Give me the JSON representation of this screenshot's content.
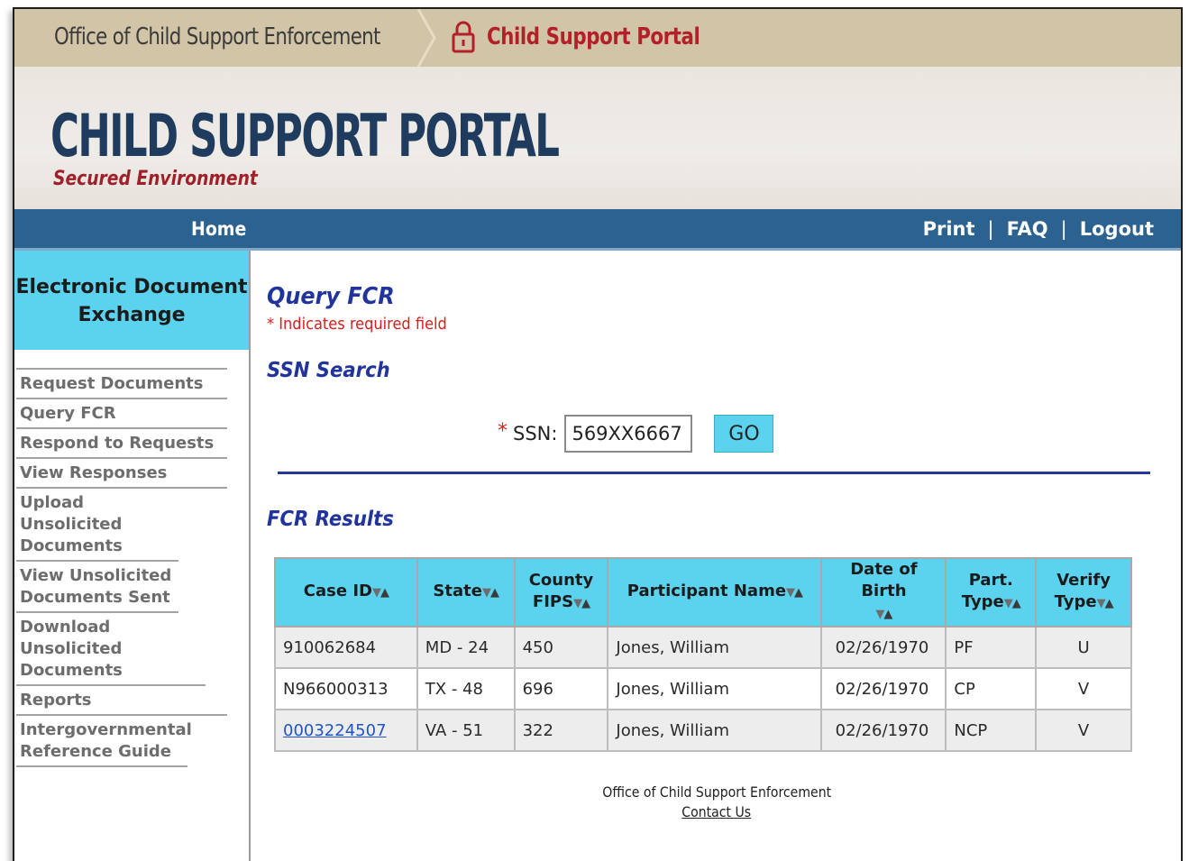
{
  "topbar": {
    "agency": "Office of Child Support Enforcement",
    "portal": "Child Support Portal",
    "lock_icon": "lock-icon"
  },
  "banner": {
    "title": "CHILD SUPPORT PORTAL",
    "subtitle": "Secured Environment"
  },
  "nav": {
    "home": "Home",
    "print": "Print",
    "faq": "FAQ",
    "logout": "Logout",
    "separator": "|"
  },
  "sidebar": {
    "heading_line1": "Electronic Document",
    "heading_line2": "Exchange",
    "items": [
      {
        "label": "Request Documents"
      },
      {
        "label": "Query FCR"
      },
      {
        "label": "Respond to Requests"
      },
      {
        "label": "View Responses"
      },
      {
        "label": "Upload Unsolicited Documents"
      },
      {
        "label": "View Unsolicited Documents Sent"
      },
      {
        "label": "Download Unsolicited Documents"
      },
      {
        "label": "Reports"
      },
      {
        "label": "Intergovernmental Reference Guide"
      }
    ]
  },
  "main": {
    "title": "Query FCR",
    "required_star": "*",
    "required_note": "Indicates required field",
    "ssn_heading": "SSN Search",
    "ssn_label": "SSN:",
    "ssn_value": "569XX6667",
    "go_label": "GO",
    "results_heading": "FCR Results"
  },
  "table": {
    "headers": {
      "case_id": "Case ID",
      "state": "State",
      "county_1": "County",
      "county_2": "FIPS",
      "participant": "Participant Name",
      "dob": "Date of Birth",
      "part_1": "Part.",
      "part_2": "Type",
      "verify_1": "Verify",
      "verify_2": "Type"
    },
    "sort_down": "▼",
    "sort_up": "▲",
    "rows": [
      {
        "case_id": "910062684",
        "state": "MD - 24",
        "county_fips": "450",
        "participant": "Jones, William",
        "dob": "02/26/1970",
        "part_type": "PF",
        "verify_type": "U"
      },
      {
        "case_id": "N966000313",
        "state": "TX - 48",
        "county_fips": "696",
        "participant": "Jones, William",
        "dob": "02/26/1970",
        "part_type": "CP",
        "verify_type": "V"
      },
      {
        "case_id": "0003224507",
        "state": "VA - 51",
        "county_fips": "322",
        "participant": "Jones, William",
        "dob": "02/26/1970",
        "part_type": "NCP",
        "verify_type": "V"
      }
    ]
  },
  "footer": {
    "org": "Office of Child Support Enforcement",
    "contact": "Contact Us"
  }
}
